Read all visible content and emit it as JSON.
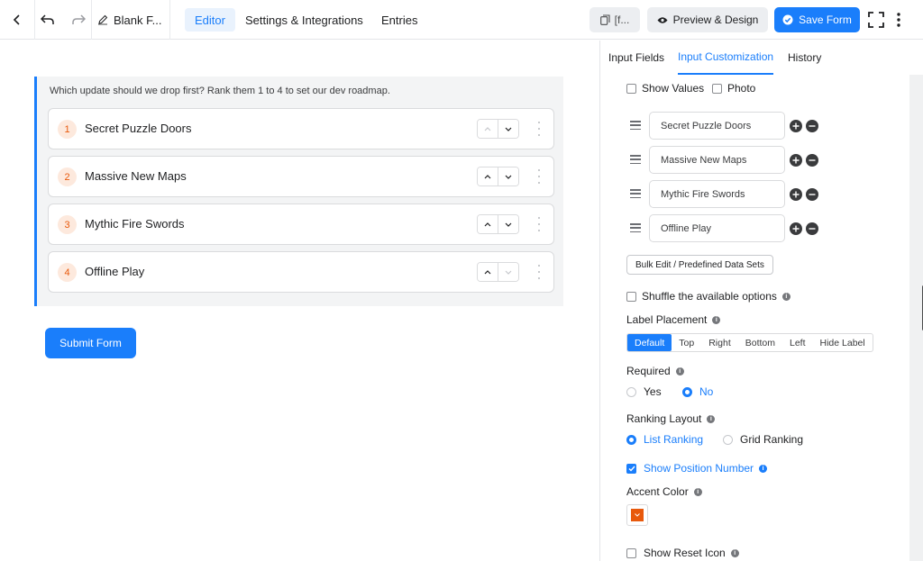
{
  "topbar": {
    "form_title": "Blank F...",
    "tabs": [
      {
        "label": "Editor",
        "active": true
      },
      {
        "label": "Settings & Integrations",
        "active": false
      },
      {
        "label": "Entries",
        "active": false
      }
    ],
    "shortcode_label": "[f...",
    "preview_label": "Preview & Design",
    "save_label": "Save Form"
  },
  "canvas": {
    "question": "Which update should we drop first? Rank them 1 to 4 to set our dev roadmap.",
    "items": [
      {
        "num": "1",
        "label": "Secret Puzzle Doors"
      },
      {
        "num": "2",
        "label": "Massive New Maps"
      },
      {
        "num": "3",
        "label": "Mythic Fire Swords"
      },
      {
        "num": "4",
        "label": "Offline Play"
      }
    ],
    "submit_label": "Submit Form"
  },
  "panel": {
    "tabs": [
      {
        "label": "Input Fields",
        "active": false
      },
      {
        "label": "Input Customization",
        "active": true
      },
      {
        "label": "History",
        "active": false
      }
    ],
    "show_values_label": "Show Values",
    "photo_label": "Photo",
    "options": [
      "Secret Puzzle Doors",
      "Massive New Maps",
      "Mythic Fire Swords",
      "Offline Play"
    ],
    "bulk_edit_label": "Bulk Edit / Predefined Data Sets",
    "shuffle_label": "Shuffle the available options",
    "label_placement_title": "Label Placement",
    "label_placement_options": [
      "Default",
      "Top",
      "Right",
      "Bottom",
      "Left",
      "Hide Label"
    ],
    "label_placement_selected": "Default",
    "required_title": "Required",
    "required_yes": "Yes",
    "required_no": "No",
    "required_selected": "No",
    "ranking_layout_title": "Ranking Layout",
    "ranking_list": "List Ranking",
    "ranking_grid": "Grid Ranking",
    "ranking_selected": "List Ranking",
    "show_position_label": "Show Position Number",
    "show_position_checked": true,
    "accent_color_title": "Accent Color",
    "accent_color": "#e8590c",
    "show_reset_label": "Show Reset Icon"
  },
  "colors": {
    "primary": "#1a7efb",
    "accent": "#e8590c"
  }
}
